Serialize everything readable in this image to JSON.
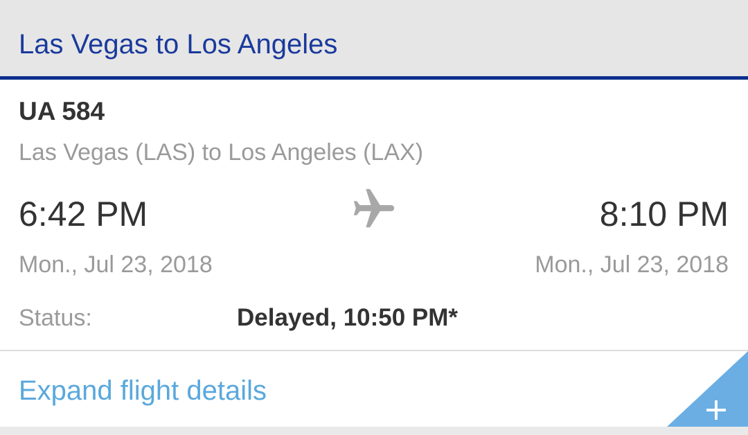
{
  "header": {
    "title": "Las Vegas to Los Angeles"
  },
  "flight": {
    "number": "UA 584",
    "route": "Las Vegas (LAS) to Los Angeles (LAX)",
    "departure_time": "6:42 PM",
    "arrival_time": "8:10 PM",
    "departure_date": "Mon., Jul 23, 2018",
    "arrival_date": "Mon., Jul 23, 2018",
    "status_label": "Status:",
    "status_value": "Delayed, 10:50 PM*"
  },
  "expand": {
    "label": "Expand flight details",
    "icon": "plus-icon"
  },
  "icons": {
    "plane": "airplane-icon"
  },
  "colors": {
    "header_bg": "#e6e6e6",
    "header_accent": "#0c2f8c",
    "title": "#1a3a9c",
    "link": "#5aa8dc",
    "corner": "#6aaee3"
  }
}
